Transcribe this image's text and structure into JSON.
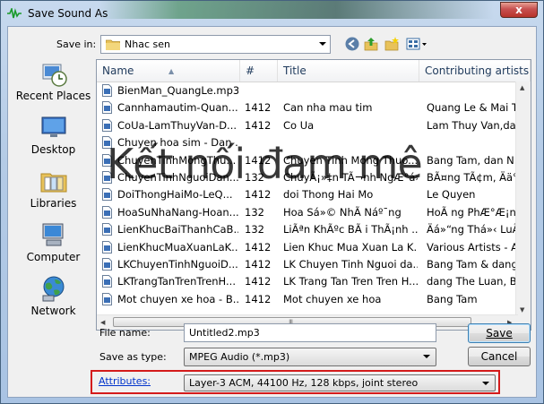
{
  "window": {
    "title": "Save Sound As",
    "close_label": "x"
  },
  "toolbar": {
    "save_in_label": "Save in:",
    "save_in_value": "Nhac sen"
  },
  "places": [
    {
      "label": "Recent Places",
      "icon": "recent-places-icon"
    },
    {
      "label": "Desktop",
      "icon": "desktop-icon"
    },
    {
      "label": "Libraries",
      "icon": "libraries-icon"
    },
    {
      "label": "Computer",
      "icon": "computer-icon"
    },
    {
      "label": "Network",
      "icon": "network-icon"
    }
  ],
  "columns": {
    "name": "Name",
    "num": "#",
    "title": "Title",
    "artist": "Contributing artists"
  },
  "files": [
    {
      "name": "BienMan_QuangLe.mp3",
      "num": "",
      "title": "",
      "artist": ""
    },
    {
      "name": "Cannhamautim-Quan...",
      "num": "1412",
      "title": "Can nha mau tim",
      "artist": "Quang Le & Mai T..."
    },
    {
      "name": "CoUa-LamThuyVan-D...",
      "num": "1412",
      "title": "Co Ua",
      "artist": "Lam Thuy Van,da..."
    },
    {
      "name": "Chuyen hoa sim - Dan ...",
      "num": "",
      "title": "",
      "artist": ""
    },
    {
      "name": "ChuyenTinhMongThu...",
      "num": "1412",
      "title": "Chuyen Tinh Mong Thuo...",
      "artist": "Bang Tam, dan N..."
    },
    {
      "name": "ChuyenTinhNguoiDan...",
      "num": "132",
      "title": "ChuyÃ¡»‡n TÃ¬nh NgÆ°á»...",
      "artist": "BÃ¤ng TÃ¢m, Ää°..."
    },
    {
      "name": "DoiThongHaiMo-LeQ...",
      "num": "1412",
      "title": "doi Thong Hai Mo",
      "artist": "Le Quyen"
    },
    {
      "name": "HoaSuNhaNang-Hoan...",
      "num": "132",
      "title": "Hoa Sá»© NhÃ  Náº¯ng",
      "artist": "HoÃ  ng PhÆ°Æ¡n..."
    },
    {
      "name": "LienKhucBaiThanhCaB...",
      "num": "132",
      "title": "LiÃªn KhÃºc BÃ i ThÃ¡nh ...",
      "artist": "Äá»“ng Thá»‹ LuÃ..."
    },
    {
      "name": "LienKhucMuaXuanLaK...",
      "num": "1412",
      "title": "Lien Khuc Mua Xuan La K...",
      "artist": "Various Artists - Al..."
    },
    {
      "name": "LKChuyenTinhNguoiD...",
      "num": "1412",
      "title": "LK Chuyen Tinh Nguoi da...",
      "artist": "Bang Tam & dang..."
    },
    {
      "name": "LKTrangTanTrenTrenH...",
      "num": "1412",
      "title": "LK Trang Tan Tren Tren H...",
      "artist": "dang The Luan, B..."
    },
    {
      "name": "Mot chuyen xe hoa - B...",
      "num": "1412",
      "title": "Mot chuyen xe hoa",
      "artist": "Bang Tam"
    }
  ],
  "form": {
    "file_name_label": "File name:",
    "file_name_value": "Untitled2.mp3",
    "save_as_type_label": "Save as type:",
    "save_as_type_value": "MPEG Audio (*.mp3)",
    "attributes_label": "Attributes:",
    "attributes_value": "Layer-3 ACM, 44100 Hz, 128 kbps, joint stereo"
  },
  "buttons": {
    "save": "Save",
    "cancel": "Cancel"
  },
  "watermark": "Kết nối đam mê",
  "colors": {
    "highlight_border": "#d41b1b",
    "link": "#0033cc"
  }
}
